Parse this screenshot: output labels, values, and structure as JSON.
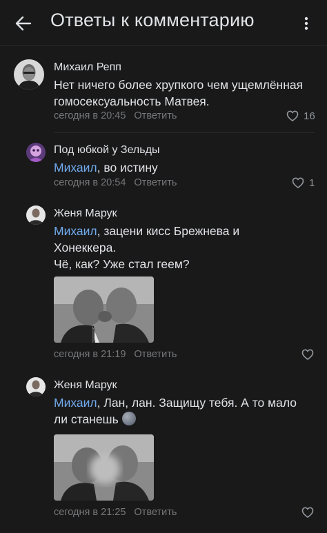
{
  "header": {
    "title": "Ответы к комментарию"
  },
  "actions": {
    "reply_label": "Ответить"
  },
  "comments": [
    {
      "author": "Михаил Репп",
      "text": "Нет ничего более хрупкого чем ущемлённая гомосексуальность Матвея.",
      "time": "сегодня в 20:45",
      "likes": "16"
    },
    {
      "author": "Под юбкой у Зельды",
      "mention": "Михаил",
      "text": ", во истину",
      "time": "сегодня в 20:54",
      "likes": "1"
    },
    {
      "author": "Женя Марук",
      "mention": "Михаил",
      "text": ", зацени кисс Брежнева и Хонеккера.",
      "text2": "Чё, как? Уже стал геем?",
      "time": "сегодня в 21:19",
      "likes": ""
    },
    {
      "author": "Женя Марук",
      "mention": "Михаил",
      "text": ", Лан, лан. Защищу тебя. А то мало ли станешь",
      "time": "сегодня в 21:25",
      "likes": ""
    }
  ],
  "icons": {
    "back": "arrow-left-icon",
    "more": "more-vertical-icon",
    "like": "heart-outline-icon"
  },
  "colors": {
    "background": "#19191a",
    "text": "#e1e3e6",
    "secondary": "#76787a",
    "mention": "#71aaeb"
  }
}
